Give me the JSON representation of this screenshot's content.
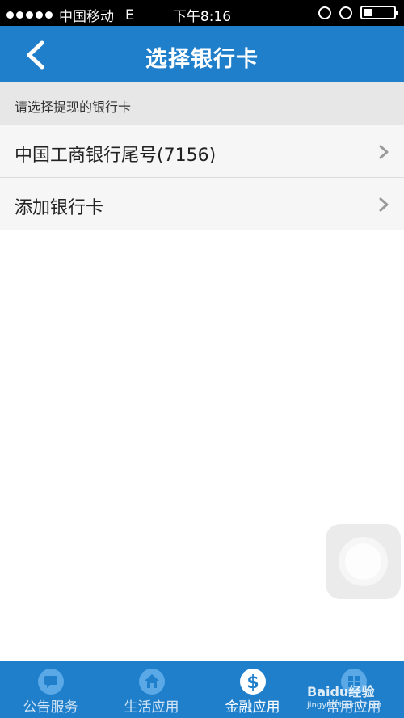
{
  "status_bar": {
    "carrier": "中国移动",
    "network": "E",
    "time": "下午8:16",
    "battery_level": 0.3
  },
  "nav": {
    "title": "选择银行卡",
    "back_icon": "chevron-left-icon"
  },
  "section_header": "请选择提现的银行卡",
  "list": {
    "items": [
      {
        "label": "中国工商银行尾号(7156)"
      },
      {
        "label": "添加银行卡"
      }
    ]
  },
  "tabs": [
    {
      "label": "公告服务",
      "icon": "chat-bubble-icon",
      "active": false
    },
    {
      "label": "生活应用",
      "icon": "home-icon",
      "active": false
    },
    {
      "label": "金融应用",
      "icon": "dollar-icon",
      "active": true
    },
    {
      "label": "常用应用",
      "icon": "grid-icon",
      "active": false
    }
  ],
  "watermark": {
    "brand": "Baidu经验",
    "url": "jingyan.baidu.com"
  },
  "colors": {
    "brand_blue": "#1f7fcb",
    "section_bg": "#e7e7e7",
    "list_bg": "#f6f6f6"
  }
}
